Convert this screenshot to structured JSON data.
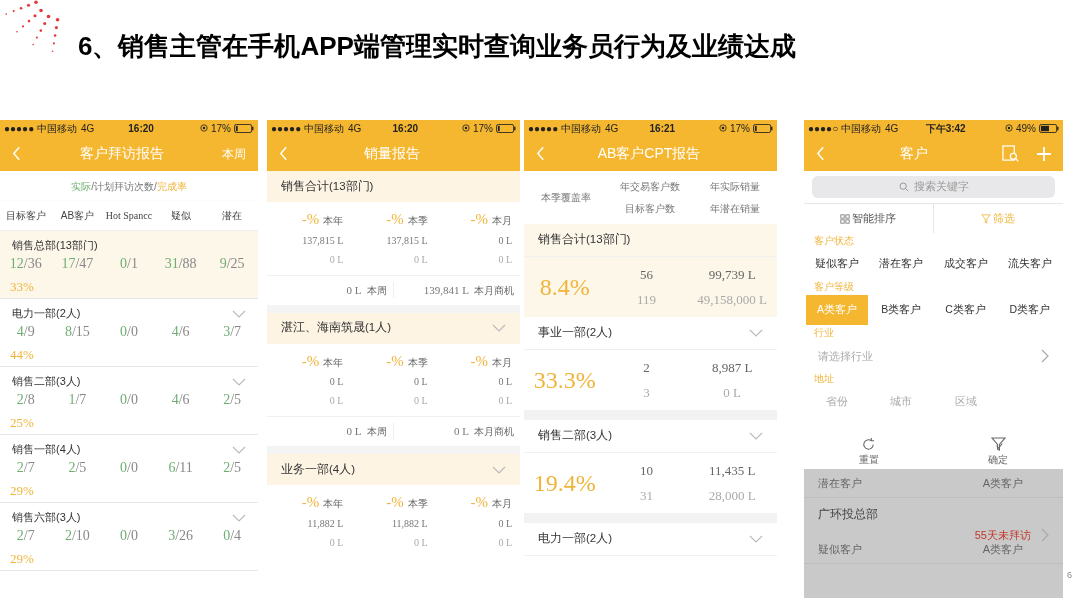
{
  "slide": {
    "title": "6、销售主管在手机APP端管理实时查询业务员行为及业绩达成",
    "page_number": "6"
  },
  "phones": [
    {
      "kind": "visit_report",
      "status_bar": {
        "carrier": "●●●●● 中国移动",
        "network": "4G",
        "time": "16:20",
        "battery": "17%"
      },
      "nav": {
        "title": "客户拜访报告",
        "action": "本周"
      },
      "legend": [
        {
          "text": "实际",
          "kind": "actual"
        },
        {
          "text": "/计划拜访次数/",
          "kind": "plan"
        },
        {
          "text": "完成率",
          "kind": "rate"
        }
      ],
      "columns": [
        "目标客户",
        "AB客户",
        "Hot Spancc",
        "疑似",
        "潜在"
      ],
      "groups": [
        {
          "name": "销售总部(13部门)",
          "highlighted": true,
          "expandable": false,
          "values": [
            "12/36",
            "17/47",
            "0/1",
            "31/88",
            "9/25"
          ],
          "rate": "33%"
        },
        {
          "name": "电力一部(2人)",
          "highlighted": false,
          "expandable": true,
          "values": [
            "4/9",
            "8/15",
            "0/0",
            "4/6",
            "3/7"
          ],
          "rate": "44%"
        },
        {
          "name": "销售二部(3人)",
          "highlighted": false,
          "expandable": true,
          "values": [
            "2/8",
            "1/7",
            "0/0",
            "4/6",
            "2/5"
          ],
          "rate": "25%"
        },
        {
          "name": "销售一部(4人)",
          "highlighted": false,
          "expandable": true,
          "values": [
            "2/7",
            "2/5",
            "0/0",
            "6/11",
            "2/5"
          ],
          "rate": "29%"
        },
        {
          "name": "销售六部(3人)",
          "highlighted": false,
          "expandable": true,
          "values": [
            "2/7",
            "2/10",
            "0/0",
            "3/26",
            "0/4"
          ],
          "rate": "29%"
        }
      ]
    },
    {
      "kind": "sales_report",
      "status_bar": {
        "carrier": "●●●●● 中国移动",
        "network": "4G",
        "time": "16:20",
        "battery": "17%"
      },
      "nav": {
        "title": "销量报告"
      },
      "groups": [
        {
          "name": "销售合计(13部门)",
          "expandable": false,
          "metrics": [
            {
              "pct": "-%",
              "period": "本年",
              "actual": "137,815 L",
              "target": "0 L"
            },
            {
              "pct": "-%",
              "period": "本季",
              "actual": "137,815 L",
              "target": "0 L"
            },
            {
              "pct": "-%",
              "period": "本月",
              "actual": "0 L",
              "target": "0 L"
            }
          ],
          "footer": [
            {
              "value": "0 L",
              "label": "本周"
            },
            {
              "value": "139,841 L",
              "label": "本月商机"
            }
          ]
        },
        {
          "name": "湛江、海南筑晟(1人)",
          "expandable": true,
          "metrics": [
            {
              "pct": "-%",
              "period": "本年",
              "actual": "0 L",
              "target": "0 L"
            },
            {
              "pct": "-%",
              "period": "本季",
              "actual": "0 L",
              "target": "0 L"
            },
            {
              "pct": "-%",
              "period": "本月",
              "actual": "0 L",
              "target": "0 L"
            }
          ],
          "footer": [
            {
              "value": "0 L",
              "label": "本周"
            },
            {
              "value": "0 L",
              "label": "本月商机"
            }
          ]
        },
        {
          "name": "业务一部(4人)",
          "expandable": true,
          "metrics": [
            {
              "pct": "-%",
              "period": "本年",
              "actual": "11,882 L",
              "target": "0 L"
            },
            {
              "pct": "-%",
              "period": "本季",
              "actual": "11,882 L",
              "target": "0 L"
            },
            {
              "pct": "-%",
              "period": "本月",
              "actual": "0 L",
              "target": "0 L"
            }
          ]
        }
      ]
    },
    {
      "kind": "cpt_report",
      "status_bar": {
        "carrier": "●●●●● 中国移动",
        "network": "4G",
        "time": "16:21",
        "battery": "17%"
      },
      "nav": {
        "title": "AB客户CPT报告"
      },
      "header": {
        "coverage": "本季覆盖率",
        "customers": [
          "年交易客户数",
          "目标客户数"
        ],
        "sales": [
          "年实际销量",
          "年潜在销量"
        ]
      },
      "groups": [
        {
          "name": "销售合计(13部门)",
          "highlighted": true,
          "expandable": false,
          "rate": "8.4%",
          "customers": [
            "56",
            "119"
          ],
          "sales": [
            "99,739 L",
            "49,158,000 L"
          ]
        },
        {
          "name": "事业一部(2人)",
          "highlighted": false,
          "expandable": true,
          "rate": "33.3%",
          "customers": [
            "2",
            "3"
          ],
          "sales": [
            "8,987 L",
            "0 L"
          ]
        },
        {
          "name": "销售二部(3人)",
          "highlighted": false,
          "expandable": true,
          "rate": "19.4%",
          "customers": [
            "10",
            "31"
          ],
          "sales": [
            "11,435 L",
            "28,000 L"
          ]
        },
        {
          "name": "电力一部(2人)",
          "highlighted": false,
          "expandable": true
        }
      ]
    },
    {
      "kind": "customer_filter",
      "status_bar": {
        "carrier": "●●●●○ 中国移动",
        "network": "4G",
        "time": "下午3:42",
        "battery": "49%"
      },
      "nav": {
        "title": "客户"
      },
      "search": {
        "placeholder": "搜索关键字"
      },
      "sort": {
        "label": "智能排序",
        "selected": false
      },
      "filter": {
        "label": "筛选",
        "selected": true
      },
      "sections": [
        {
          "label": "客户状态",
          "kind": "options",
          "options": [
            {
              "label": "疑似客户",
              "selected": false
            },
            {
              "label": "潜在客户",
              "selected": false
            },
            {
              "label": "成交客户",
              "selected": false
            },
            {
              "label": "流失客户",
              "selected": false
            }
          ]
        },
        {
          "label": "客户等级",
          "kind": "options",
          "options": [
            {
              "label": "A类客户",
              "selected": true
            },
            {
              "label": "B类客户",
              "selected": false
            },
            {
              "label": "C类客户",
              "selected": false
            },
            {
              "label": "D类客户",
              "selected": false
            }
          ]
        },
        {
          "label": "行业",
          "kind": "select",
          "placeholder": "请选择行业"
        },
        {
          "label": "地址",
          "kind": "placeholders",
          "options": [
            {
              "label": "省份"
            },
            {
              "label": "城市"
            },
            {
              "label": "区域"
            }
          ]
        }
      ],
      "actions": [
        {
          "label": "重置",
          "kind": "reset"
        },
        {
          "label": "确定",
          "kind": "confirm"
        }
      ],
      "list": [
        {
          "status": "潜在客户",
          "level": "A类客户"
        },
        {
          "name": "广环投总部",
          "alert": "55天未拜访",
          "status": "疑似客户",
          "level": "A类客户"
        }
      ]
    }
  ]
}
